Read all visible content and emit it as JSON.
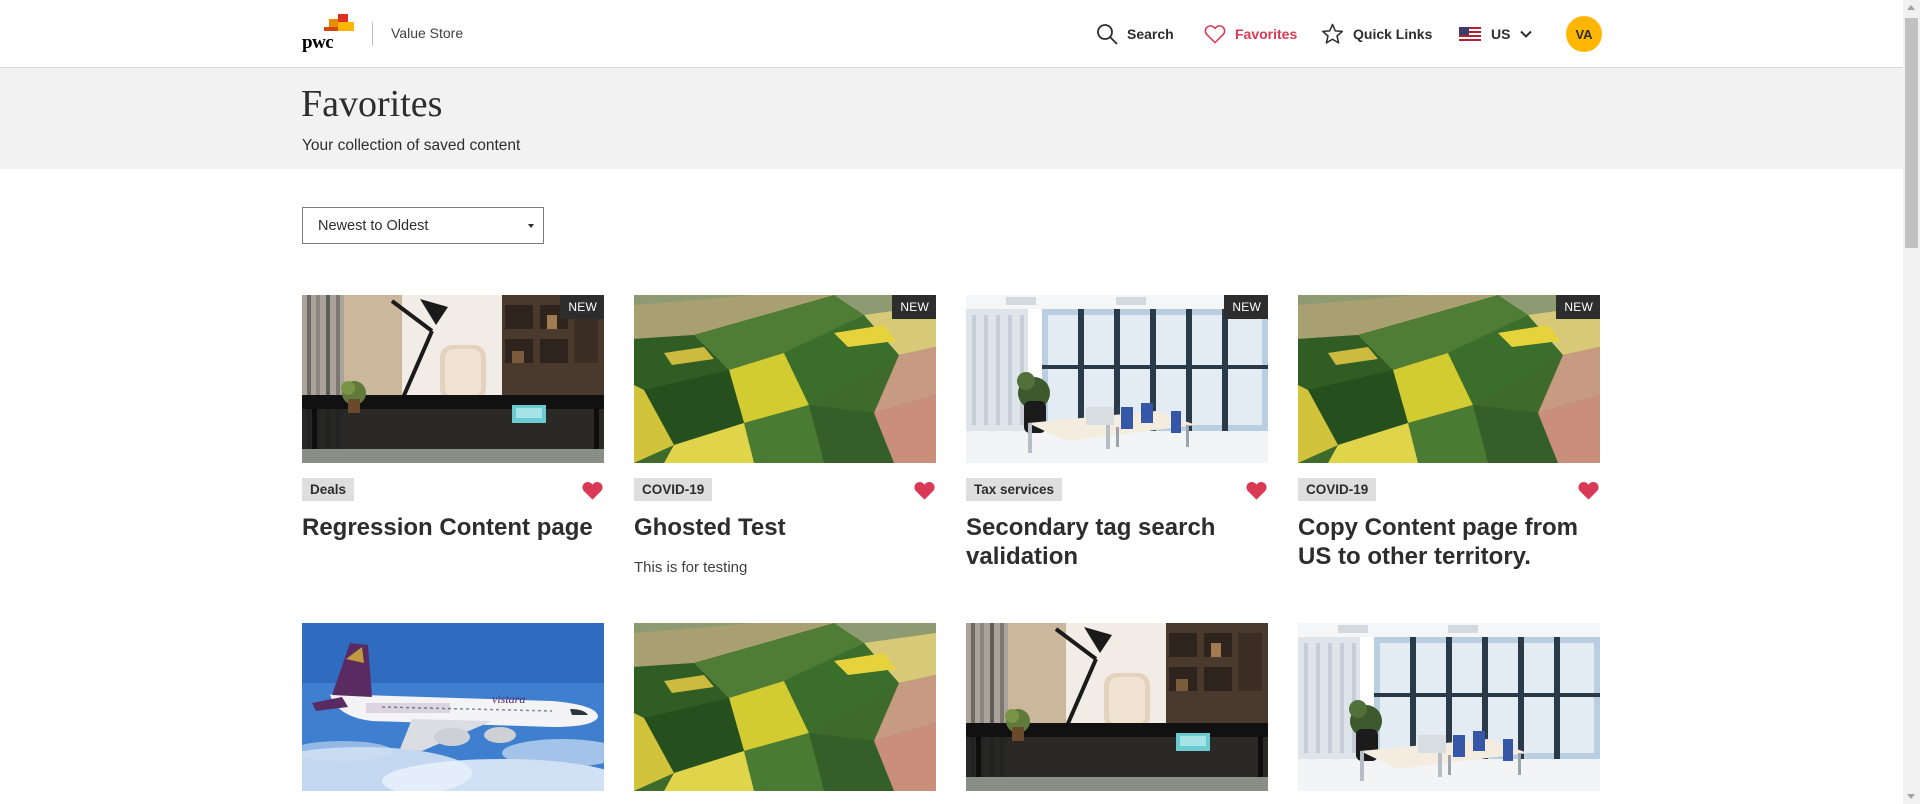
{
  "header": {
    "brand_wordmark": "pwc",
    "store_name": "Value Store",
    "nav": {
      "search_label": "Search",
      "favorites_label": "Favorites",
      "quick_links_label": "Quick Links",
      "locale_label": "US"
    },
    "avatar_initials": "VA",
    "active_color": "#d93954",
    "avatar_color": "#ffb600"
  },
  "page": {
    "title": "Favorites",
    "subtitle": "Your collection of saved content"
  },
  "sort": {
    "selected": "Newest to Oldest"
  },
  "cards": [
    {
      "badge": "NEW",
      "tag": "Deals",
      "title": "Regression Content page",
      "description": "",
      "image": "home-office-desk",
      "favorited": true
    },
    {
      "badge": "NEW",
      "tag": "COVID-19",
      "title": "Ghosted Test",
      "description": "This is for testing",
      "image": "aerial-farmland",
      "favorited": true
    },
    {
      "badge": "NEW",
      "tag": "Tax services",
      "title": "Secondary tag search validation",
      "description": "",
      "image": "modern-office",
      "favorited": true
    },
    {
      "badge": "NEW",
      "tag": "COVID-19",
      "title": "Copy Content page from US to other territory.",
      "description": "",
      "image": "aerial-farmland",
      "favorited": true
    },
    {
      "image": "airplane"
    },
    {
      "image": "aerial-farmland"
    },
    {
      "image": "home-office-desk"
    },
    {
      "image": "modern-office"
    }
  ]
}
